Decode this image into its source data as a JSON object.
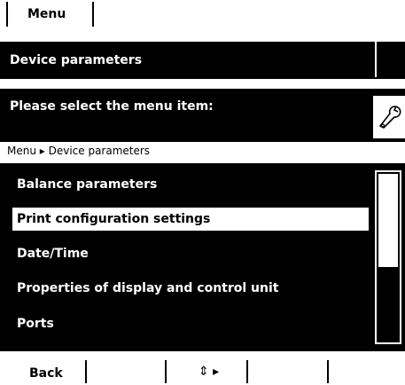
{
  "top_tab": {
    "label": "Menu"
  },
  "title_bar": {
    "title": "Device parameters"
  },
  "prompt": {
    "text": "Please select the menu item:"
  },
  "breadcrumb": "Menu ▸ Device parameters",
  "list": {
    "items": [
      {
        "label": "Balance parameters",
        "selected": false
      },
      {
        "label": "Print configuration settings",
        "selected": true
      },
      {
        "label": "Date/Time",
        "selected": false
      },
      {
        "label": "Properties of display and control unit",
        "selected": false
      },
      {
        "label": "Ports",
        "selected": false
      }
    ],
    "scroll_fraction_visible": 0.56
  },
  "softkeys": {
    "back": "Back",
    "nav": "⇕ ▸"
  },
  "icons": {
    "wrench": "wrench-icon"
  }
}
